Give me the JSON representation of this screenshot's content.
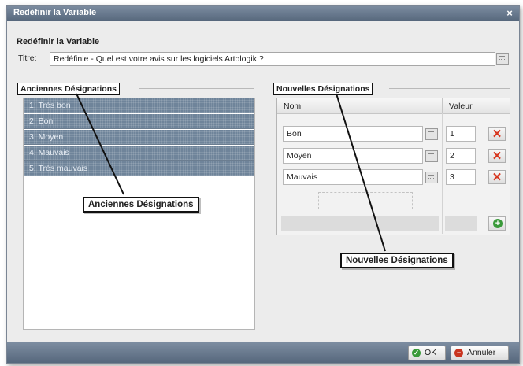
{
  "window": {
    "title": "Redéfinir la Variable",
    "close": "×"
  },
  "section": {
    "label": "Redéfinir la Variable"
  },
  "titre": {
    "label": "Titre:",
    "value": "Redéfinie - Quel est votre avis sur les logiciels Artologik ?"
  },
  "left": {
    "label": "Anciennes Désignations",
    "items": [
      "1: Très bon",
      "2: Bon",
      "3: Moyen",
      "4: Mauvais",
      "5: Très mauvais"
    ],
    "callout": "Anciennes Désignations"
  },
  "right": {
    "label": "Nouvelles Désignations",
    "columns": {
      "nom": "Nom",
      "valeur": "Valeur"
    },
    "rows": [
      {
        "nom": "Bon",
        "valeur": "1"
      },
      {
        "nom": "Moyen",
        "valeur": "2"
      },
      {
        "nom": "Mauvais",
        "valeur": "3"
      }
    ],
    "delete_glyph": "✕",
    "add_glyph": "+",
    "callout": "Nouvelles Désignations"
  },
  "footer": {
    "ok": "OK",
    "cancel": "Annuler",
    "ok_glyph": "✓",
    "cancel_glyph": "−"
  },
  "colors": {
    "titlebar": "#6a7a8f",
    "list_item": "#6f849a",
    "delete": "#d8361f",
    "add": "#3a9a3a"
  }
}
